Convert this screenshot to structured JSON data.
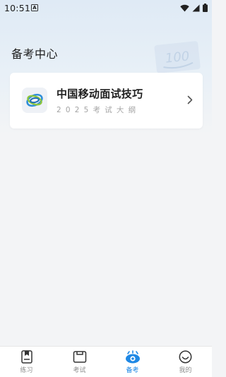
{
  "status": {
    "time": "10:51",
    "notification_glyph": "A"
  },
  "header": {
    "title": "备考中心",
    "decoration_text": "100"
  },
  "card": {
    "title": "中国移动面试技巧",
    "subtitle": "2025考试大纲",
    "logo_icon": "china-mobile-logo",
    "chevron_icon": "chevron-right-icon"
  },
  "tabs": [
    {
      "label": "练习",
      "icon": "practice-icon"
    },
    {
      "label": "考试",
      "icon": "exam-icon"
    },
    {
      "label": "备考",
      "icon": "prepare-eye-icon",
      "active": true
    },
    {
      "label": "我的",
      "icon": "profile-smile-icon"
    }
  ],
  "colors": {
    "accent": "#1e88e5",
    "inactive": "#8d8d8d",
    "background": "#f3f4f6"
  }
}
